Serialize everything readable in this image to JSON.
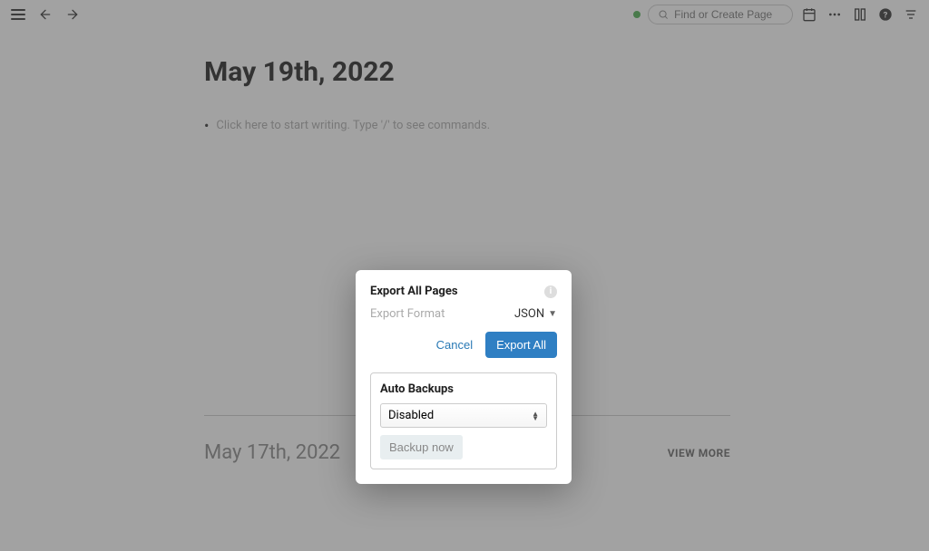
{
  "topbar": {
    "search_placeholder": "Find or Create Page"
  },
  "page": {
    "title": "May 19th, 2022",
    "placeholder": "Click here to start writing. Type '/' to see commands."
  },
  "previous": {
    "date": "May 17th, 2022",
    "view_more": "VIEW MORE"
  },
  "dialog": {
    "title": "Export All Pages",
    "format_label": "Export Format",
    "format_value": "JSON",
    "cancel": "Cancel",
    "export_all": "Export All",
    "backup_title": "Auto Backups",
    "backup_select": "Disabled",
    "backup_now": "Backup now"
  }
}
